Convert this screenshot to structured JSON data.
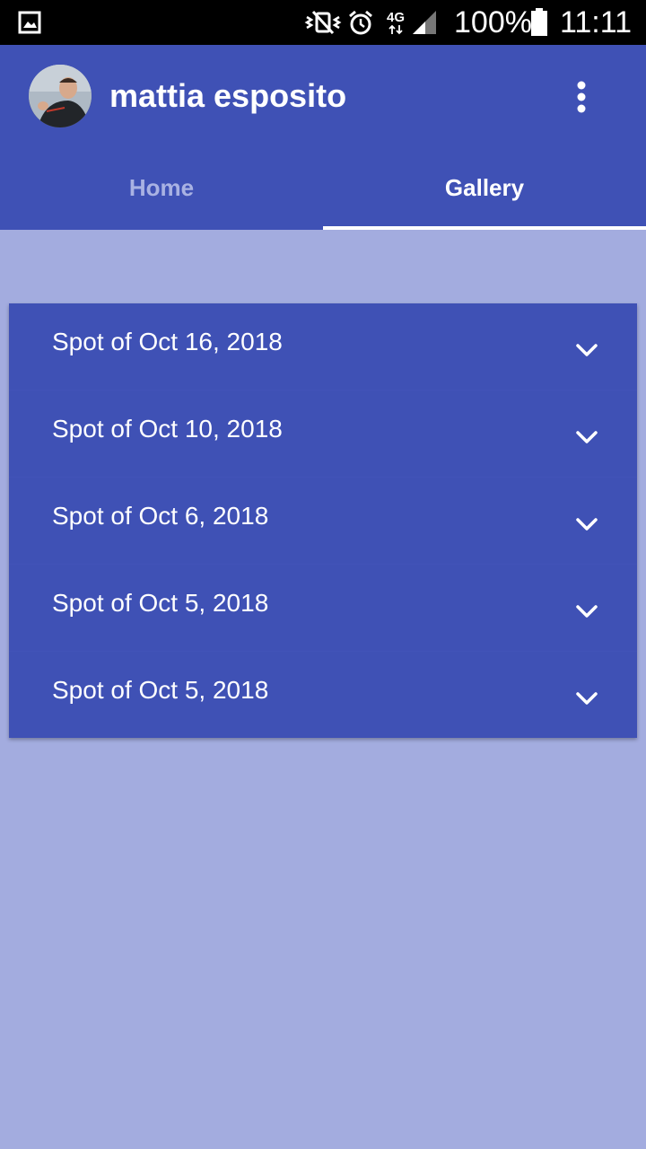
{
  "status_bar": {
    "battery_percent": "100%",
    "time": "11:11",
    "network": "4G",
    "icons": [
      "image-icon",
      "mute-vibrate-icon",
      "alarm-icon",
      "network-4g-icon",
      "signal-icon",
      "battery-icon"
    ]
  },
  "header": {
    "user_name": "mattia esposito",
    "avatar_icon": "avatar",
    "menu_icon": "more-vert-icon"
  },
  "tabs": [
    {
      "label": "Home",
      "selected": false
    },
    {
      "label": "Gallery",
      "selected": true
    }
  ],
  "spots": [
    {
      "label": "Spot of Oct 16, 2018"
    },
    {
      "label": "Spot of Oct 10, 2018"
    },
    {
      "label": "Spot of Oct 6, 2018"
    },
    {
      "label": "Spot of Oct 5, 2018"
    },
    {
      "label": "Spot of Oct 5, 2018"
    }
  ],
  "colors": {
    "primary": "#3f51b5",
    "background": "#a3acdf",
    "inactive_tab": "#a9b2e3",
    "text": "#ffffff"
  }
}
